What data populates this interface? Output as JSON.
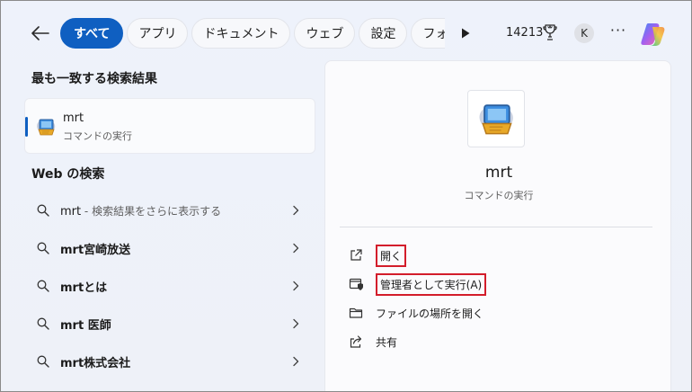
{
  "tabs": [
    {
      "label": "すべて",
      "active": true
    },
    {
      "label": "アプリ",
      "active": false
    },
    {
      "label": "ドキュメント",
      "active": false
    },
    {
      "label": "ウェブ",
      "active": false
    },
    {
      "label": "設定",
      "active": false
    },
    {
      "label": "フォルダー",
      "active": false
    }
  ],
  "header": {
    "points": "14213",
    "avatar_letter": "K",
    "more": "···"
  },
  "best_match": {
    "section_title": "最も一致する検索結果",
    "name": "mrt",
    "type": "コマンドの実行"
  },
  "web": {
    "section_title": "Web の検索",
    "items": [
      {
        "query": "mrt",
        "suffix": " - 検索結果をさらに表示する"
      },
      {
        "query": "mrt宮崎放送",
        "suffix": ""
      },
      {
        "query": "mrtとは",
        "suffix": ""
      },
      {
        "query": "mrt 医師",
        "suffix": ""
      },
      {
        "query": "mrt株式会社",
        "suffix": ""
      }
    ]
  },
  "detail": {
    "title": "mrt",
    "subtitle": "コマンドの実行",
    "actions": [
      {
        "label": "開く",
        "icon": "open-external-icon",
        "highlighted": true
      },
      {
        "label": "管理者として実行(A)",
        "icon": "shield-window-icon",
        "highlighted": true
      },
      {
        "label": "ファイルの場所を開く",
        "icon": "folder-icon",
        "highlighted": false
      },
      {
        "label": "共有",
        "icon": "share-icon",
        "highlighted": false
      }
    ]
  },
  "colors": {
    "accent": "#0f5fc1",
    "highlight_box": "#d31d2b"
  }
}
